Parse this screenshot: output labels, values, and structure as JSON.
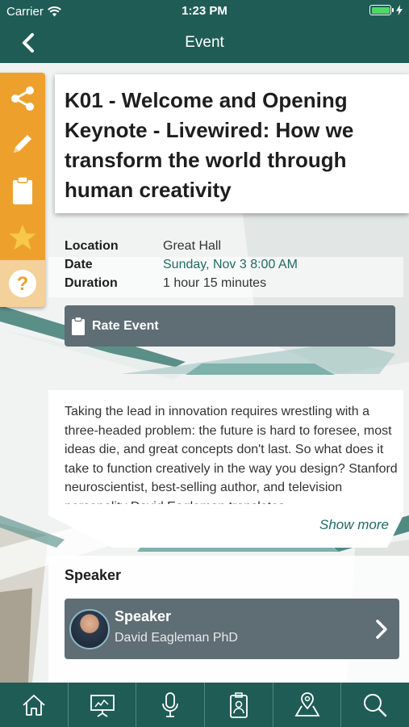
{
  "status_bar": {
    "carrier": "Carrier",
    "time": "1:23 PM"
  },
  "nav": {
    "title": "Event",
    "back_icon": "chevron-left-icon"
  },
  "side_menu": {
    "items": [
      "share-icon",
      "pencil-icon",
      "clipboard-icon",
      "star-icon",
      "help-icon"
    ]
  },
  "event": {
    "title": "K01 - Welcome and Opening Keynote - Livewired: How we transform the world through human creativity",
    "location_label": "Location",
    "location": "Great Hall",
    "date_label": "Date",
    "date": "Sunday, Nov 3 8:00 AM",
    "duration_label": "Duration",
    "duration": "1 hour 15 minutes",
    "rate_label": "Rate Event",
    "description": "Taking the lead in innovation requires wrestling with a three-headed problem: the future is hard to foresee, most ideas die, and great concepts don't last.  So what does it take to function creatively in the way you design?  Stanford neuroscientist, best-selling author, and television personality David Eagleman translates",
    "show_more": "Show more"
  },
  "speaker": {
    "heading": "Speaker",
    "card_title": "Speaker",
    "name": "David Eagleman PhD"
  },
  "tab_bar": {
    "tabs": [
      "home-icon",
      "presentation-icon",
      "microphone-icon",
      "badge-icon",
      "map-pin-icon",
      "search-icon"
    ]
  },
  "colors": {
    "primary": "#1f5c56",
    "accent": "#eda12c",
    "card": "#5f6d75",
    "link": "#1f6b63"
  }
}
